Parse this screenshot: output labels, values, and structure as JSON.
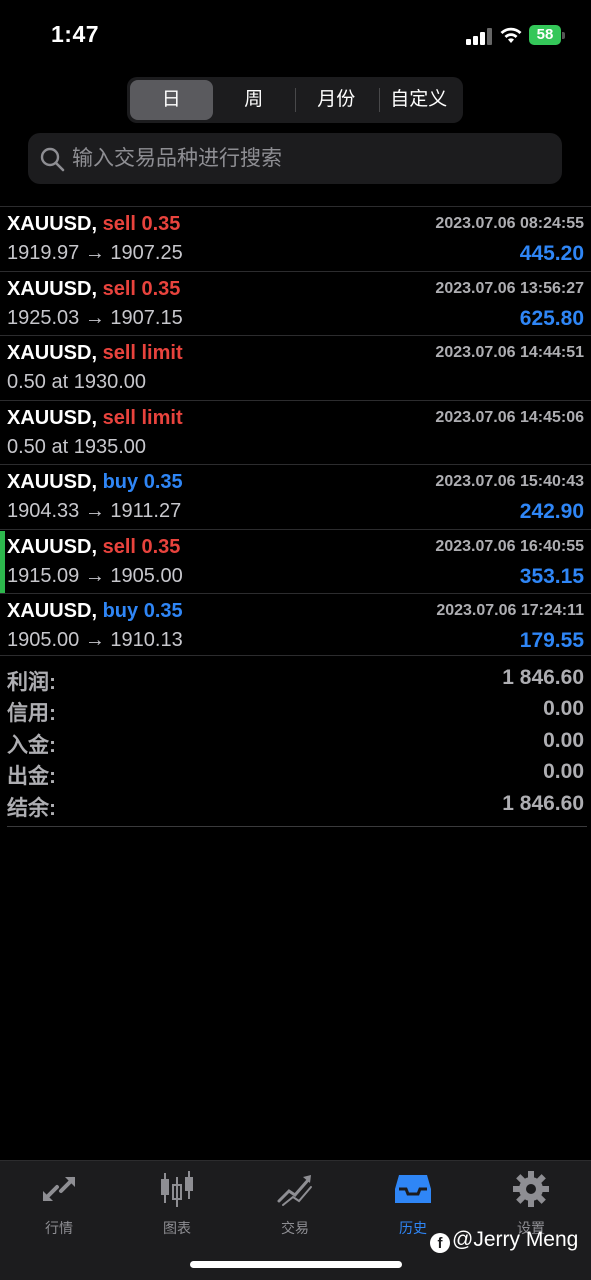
{
  "status_bar": {
    "time": "1:47",
    "battery": "58"
  },
  "segments": [
    "日",
    "周",
    "月份",
    "自定义"
  ],
  "active_segment": 0,
  "search": {
    "placeholder": "输入交易品种进行搜索"
  },
  "trades": [
    {
      "symbol": "XAUUSD,",
      "type": "sell 0.35",
      "side": "sell",
      "datetime": "2023.07.06 08:24:55",
      "prices": "1919.97 → 1907.25",
      "profit": "445.20"
    },
    {
      "symbol": "XAUUSD,",
      "type": "sell 0.35",
      "side": "sell",
      "datetime": "2023.07.06 13:56:27",
      "prices": "1925.03 → 1907.15",
      "profit": "625.80"
    },
    {
      "symbol": "XAUUSD,",
      "type": "sell limit",
      "side": "sell",
      "datetime": "2023.07.06 14:44:51",
      "prices": "0.50 at 1930.00",
      "profit": ""
    },
    {
      "symbol": "XAUUSD,",
      "type": "sell limit",
      "side": "sell",
      "datetime": "2023.07.06 14:45:06",
      "prices": "0.50 at 1935.00",
      "profit": ""
    },
    {
      "symbol": "XAUUSD,",
      "type": "buy 0.35",
      "side": "buy",
      "datetime": "2023.07.06 15:40:43",
      "prices": "1904.33 → 1911.27",
      "profit": "242.90"
    },
    {
      "symbol": "XAUUSD,",
      "type": "sell 0.35",
      "side": "sell",
      "datetime": "2023.07.06 16:40:55",
      "prices": "1915.09 → 1905.00",
      "profit": "353.15"
    },
    {
      "symbol": "XAUUSD,",
      "type": "buy 0.35",
      "side": "buy",
      "datetime": "2023.07.06 17:24:11",
      "prices": "1905.00 → 1910.13",
      "profit": "179.55"
    }
  ],
  "selected_trade": 5,
  "summary": [
    {
      "label": "利润:",
      "value": "1 846.60"
    },
    {
      "label": "信用:",
      "value": "0.00"
    },
    {
      "label": "入金:",
      "value": "0.00"
    },
    {
      "label": "出金:",
      "value": "0.00"
    },
    {
      "label": "结余:",
      "value": "1 846.60"
    }
  ],
  "tabs": [
    {
      "label": "行情",
      "icon": "quotes-icon"
    },
    {
      "label": "图表",
      "icon": "chart-icon"
    },
    {
      "label": "交易",
      "icon": "trade-icon"
    },
    {
      "label": "历史",
      "icon": "history-icon"
    },
    {
      "label": "设置",
      "icon": "gear-icon"
    }
  ],
  "active_tab": 3,
  "watermark": "@Jerry Meng",
  "colors": {
    "sell": "#e8433d",
    "buy": "#2f86f6",
    "selected_marker": "#2db84d",
    "accent": "#2f86f6"
  }
}
